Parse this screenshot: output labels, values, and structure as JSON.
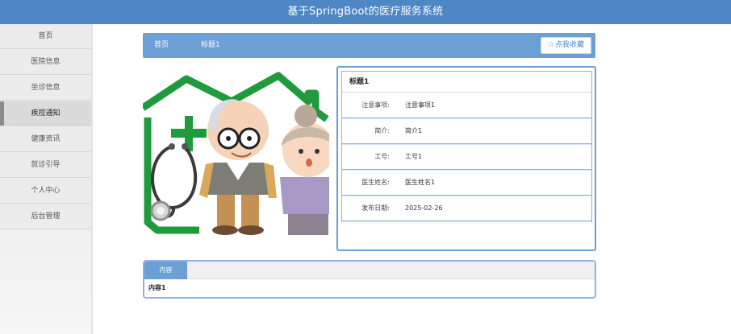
{
  "app": {
    "title": "基于SpringBoot的医疗服务系统"
  },
  "sidebar": {
    "items": [
      {
        "label": "首页",
        "active": false
      },
      {
        "label": "医院信息",
        "active": false
      },
      {
        "label": "坐诊信息",
        "active": false
      },
      {
        "label": "疾控通知",
        "active": true
      },
      {
        "label": "健康资讯",
        "active": false
      },
      {
        "label": "就诊引导",
        "active": false
      },
      {
        "label": "个人中心",
        "active": false
      },
      {
        "label": "后台管理",
        "active": false
      }
    ]
  },
  "breadcrumb": {
    "home": "首页",
    "current": "标题1"
  },
  "actions": {
    "collect_label": "点我收藏",
    "collect_icon": "star-outline-icon"
  },
  "photo": {
    "icon": "elderly-couple-hospital-illustration"
  },
  "detail": {
    "title": "标题1",
    "rows": [
      {
        "label": "注意事项:",
        "value": "注意事项1"
      },
      {
        "label": "简介:",
        "value": "简介1"
      },
      {
        "label": "工号:",
        "value": "工号1"
      },
      {
        "label": "医生姓名:",
        "value": "医生姓名1"
      },
      {
        "label": "发布日期:",
        "value": "2025-02-26"
      }
    ]
  },
  "content": {
    "tab_label": "内容",
    "text": "内容1"
  },
  "colors": {
    "primary": "#4f86c6",
    "accent": "#6b9fd6",
    "hospital_green": "#1f9a3c"
  }
}
